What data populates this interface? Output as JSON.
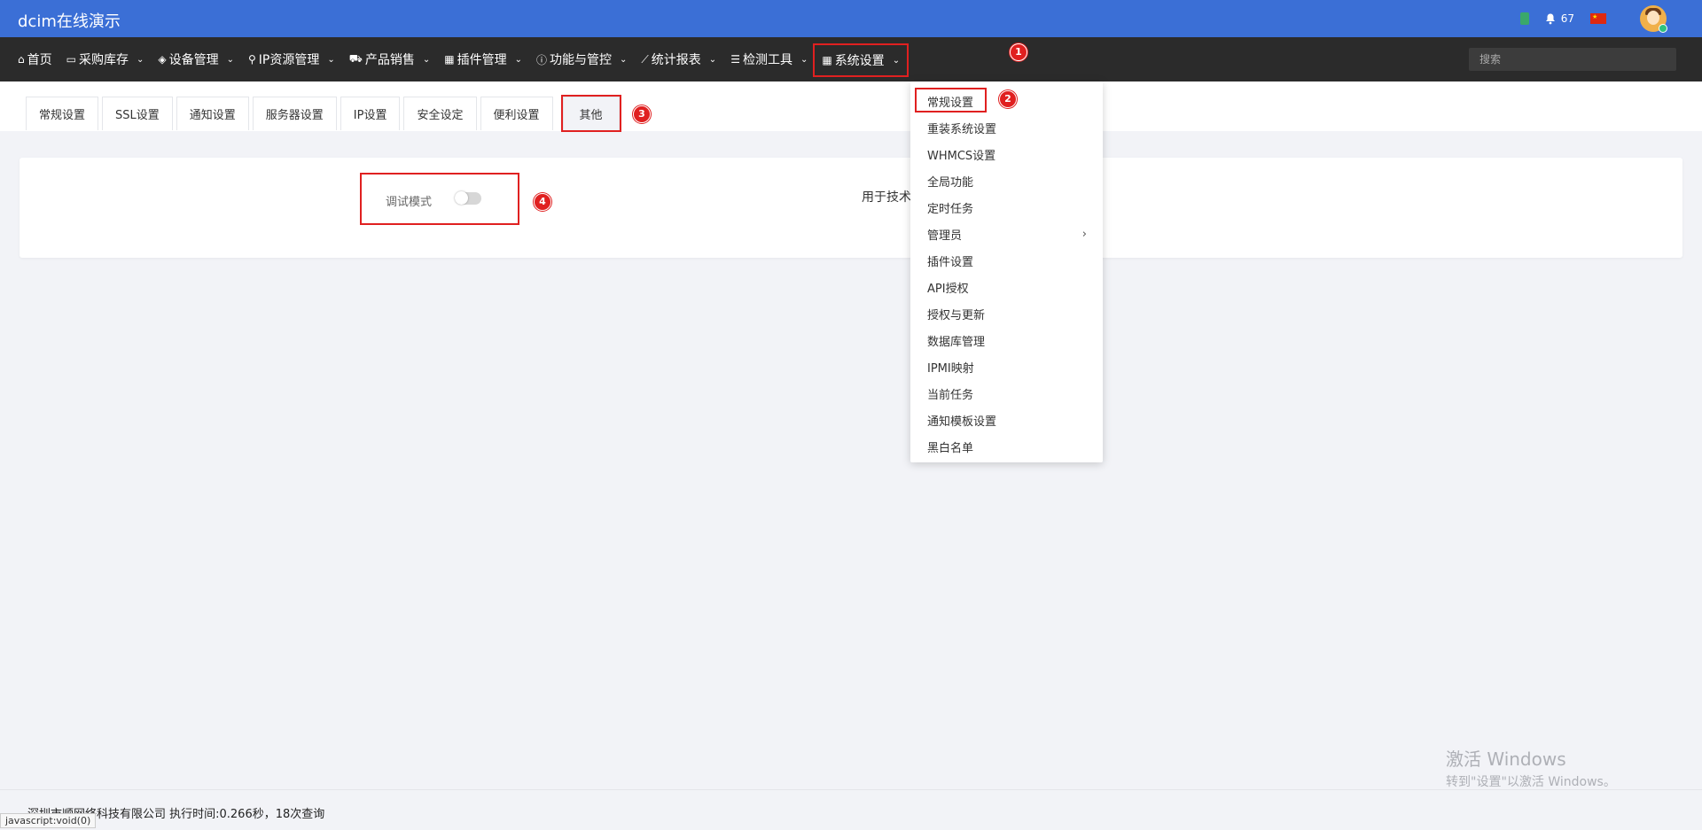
{
  "header": {
    "title": "dcim在线演示",
    "notification_count": "67"
  },
  "nav": {
    "items": [
      {
        "label": "首页",
        "icon": "home-icon",
        "caret": false
      },
      {
        "label": "采购库存",
        "icon": "inbox-icon",
        "caret": true
      },
      {
        "label": "设备管理",
        "icon": "cube-icon",
        "caret": true
      },
      {
        "label": "IP资源管理",
        "icon": "map-marker-icon",
        "caret": true
      },
      {
        "label": "产品销售",
        "icon": "cart-icon",
        "caret": true
      },
      {
        "label": "插件管理",
        "icon": "grid-icon",
        "caret": true
      },
      {
        "label": "功能与管控",
        "icon": "info-circle-icon",
        "caret": true
      },
      {
        "label": "统计报表",
        "icon": "line-chart-icon",
        "caret": true
      },
      {
        "label": "检测工具",
        "icon": "list-icon",
        "caret": true
      },
      {
        "label": "系统设置",
        "icon": "windows-icon",
        "caret": true
      }
    ],
    "search_placeholder": "搜索"
  },
  "tabs": [
    "常规设置",
    "SSL设置",
    "通知设置",
    "服务器设置",
    "IP设置",
    "安全设定",
    "便利设置",
    "其他"
  ],
  "active_tab": "其他",
  "settings": {
    "debug_label": "调试模式",
    "debug_enabled": false,
    "description": "用于技术"
  },
  "dropdown": {
    "items": [
      "常规设置",
      "重装系统设置",
      "WHMCS设置",
      "全局功能",
      "定时任务",
      "管理员",
      "插件设置",
      "API授权",
      "授权与更新",
      "数据库管理",
      "IPMI映射",
      "当前任务",
      "通知模板设置",
      "黑白名单"
    ],
    "submenu_arrow": "›"
  },
  "annotations": [
    "1",
    "2",
    "3",
    "4"
  ],
  "footer": {
    "text": "深圳市顺网络科技有限公司   执行时间:0.266秒，18次查询",
    "status_url": "javascript:void(0)"
  },
  "watermark": {
    "line1": "激活 Windows",
    "line2": "转到\"设置\"以激活 Windows。"
  },
  "colors": {
    "topbar": "#3b6fd6",
    "navbar": "#2b2b2b",
    "highlight": "#e02020"
  }
}
